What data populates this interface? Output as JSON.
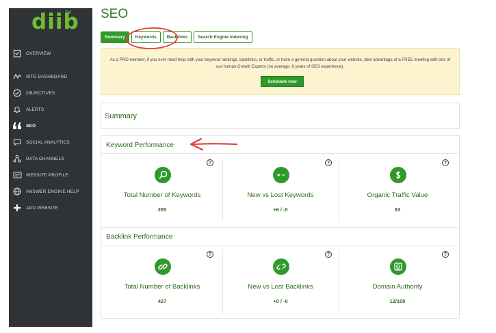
{
  "brand": {
    "logo_text": "diib",
    "tm": "TM"
  },
  "sidebar": {
    "items": [
      {
        "label": "OVERVIEW",
        "icon": "clipboard-check-icon"
      },
      {
        "label": "SITE DASHBOARD",
        "icon": "activity-pulse-icon"
      },
      {
        "label": "OBJECTIVES",
        "icon": "check-circle-icon"
      },
      {
        "label": "ALERTS",
        "icon": "bell-icon"
      },
      {
        "label": "SEO",
        "icon": "quote-icon",
        "active": true
      },
      {
        "label": "SOCIAL ANALYTICS",
        "icon": "chat-bubble-icon"
      },
      {
        "label": "DATA CHANNELS",
        "icon": "network-nodes-icon"
      },
      {
        "label": "WEBSITE PROFILE",
        "icon": "id-card-icon"
      },
      {
        "label": "ANSWER ENGINE HELP",
        "icon": "globe-icon"
      },
      {
        "label": "ADD WEBSITE",
        "icon": "plus-icon"
      }
    ]
  },
  "header": {
    "title": "SEO"
  },
  "tabs": [
    "Summary",
    "Keywords",
    "Backlinks",
    "Search Engine Indexing"
  ],
  "promo": {
    "text": "As a PRO member, if you ever need help with your keyword rankings, backlinks, or traffic, or have a general question about your website, take advantage of a FREE meeting with one of our human Growth Experts (on average, 8 years of SEO experience).",
    "button": "Schedule now"
  },
  "summary": {
    "title": "Summary"
  },
  "keyword_performance": {
    "title": "Keyword Performance",
    "metrics": [
      {
        "label": "Total Number of Keywords",
        "value": "285",
        "icon": "magnifier-icon"
      },
      {
        "label": "New vs Lost Keywords",
        "value": "+6 / -0",
        "icon": "plus-minus-icon"
      },
      {
        "label": "Organic Traffic Value",
        "value": "$3",
        "icon": "dollar-icon"
      }
    ]
  },
  "backlink_performance": {
    "title": "Backlink Performance",
    "metrics": [
      {
        "label": "Total Number of Backlinks",
        "value": "427",
        "icon": "link-icon"
      },
      {
        "label": "New vs Lost Backlinks",
        "value": "+0 / -0",
        "icon": "broken-link-icon"
      },
      {
        "label": "Domain Authority",
        "value": "12/100",
        "icon": "certificate-icon"
      }
    ]
  },
  "help_glyph": "?",
  "colors": {
    "accent": "#2f9a2a",
    "sidebar": "#303336",
    "logo": "#6cbf2f",
    "promo_bg": "#fcf3cf",
    "annotation": "#e2403a"
  }
}
